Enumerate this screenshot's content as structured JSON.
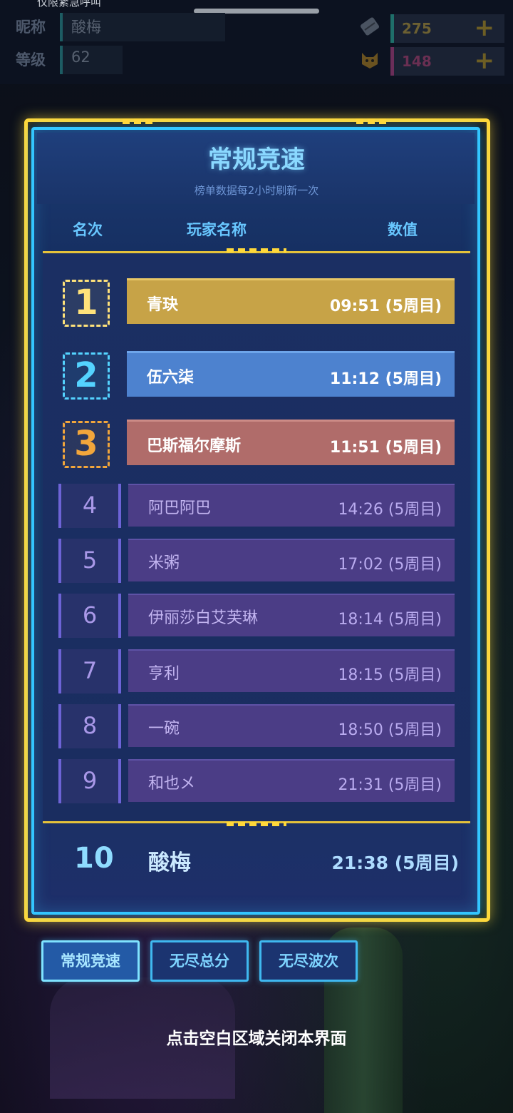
{
  "status_bar": {
    "text": "仅限紧急呼叫"
  },
  "hud": {
    "nickname_label": "昵称",
    "nickname_value": "酸梅",
    "level_label": "等级",
    "level_value": "62",
    "resource1": {
      "value": "275",
      "color": "#c8a536",
      "icon": "ticket-icon"
    },
    "resource2": {
      "value": "148",
      "color": "#b2478c",
      "icon": "cat-icon"
    },
    "plus": "+"
  },
  "panel": {
    "title": "常规竞速",
    "subtitle": "榜单数据每2小时刷新一次",
    "col_rank": "名次",
    "col_player": "玩家名称",
    "col_value": "数值"
  },
  "leaderboard": [
    {
      "rank": "1",
      "name": "青玦",
      "score": "09:51 (5周目)",
      "color": "#c7a347",
      "border": "#ffe27a"
    },
    {
      "rank": "2",
      "name": "伍六柒",
      "score": "11:12 (5周目)",
      "color": "#4d82cf",
      "border": "#54d3ff"
    },
    {
      "rank": "3",
      "name": "巴斯福尔摩斯",
      "score": "11:51 (5周目)",
      "color": "#b06c6a",
      "border": "#f2a63b"
    },
    {
      "rank": "4",
      "name": "阿巴阿巴",
      "score": "14:26 (5周目)"
    },
    {
      "rank": "5",
      "name": "米粥",
      "score": "17:02 (5周目)"
    },
    {
      "rank": "6",
      "name": "伊丽莎白艾芙琳",
      "score": "18:14 (5周目)"
    },
    {
      "rank": "7",
      "name": "亨利",
      "score": "18:15 (5周目)"
    },
    {
      "rank": "8",
      "name": "一碗",
      "score": "18:50 (5周目)"
    },
    {
      "rank": "9",
      "name": "和也メ",
      "score": "21:31 (5周目)"
    }
  ],
  "my_entry": {
    "rank": "10",
    "name": "酸梅",
    "score": "21:38 (5周目)"
  },
  "tabs": [
    {
      "label": "常规竞速",
      "active": true
    },
    {
      "label": "无尽总分",
      "active": false
    },
    {
      "label": "无尽波次",
      "active": false
    }
  ],
  "close_hint": "点击空白区域关闭本界面",
  "colors": {
    "frame_gold": "#ffd83a",
    "frame_cyan": "#33c6ff"
  }
}
